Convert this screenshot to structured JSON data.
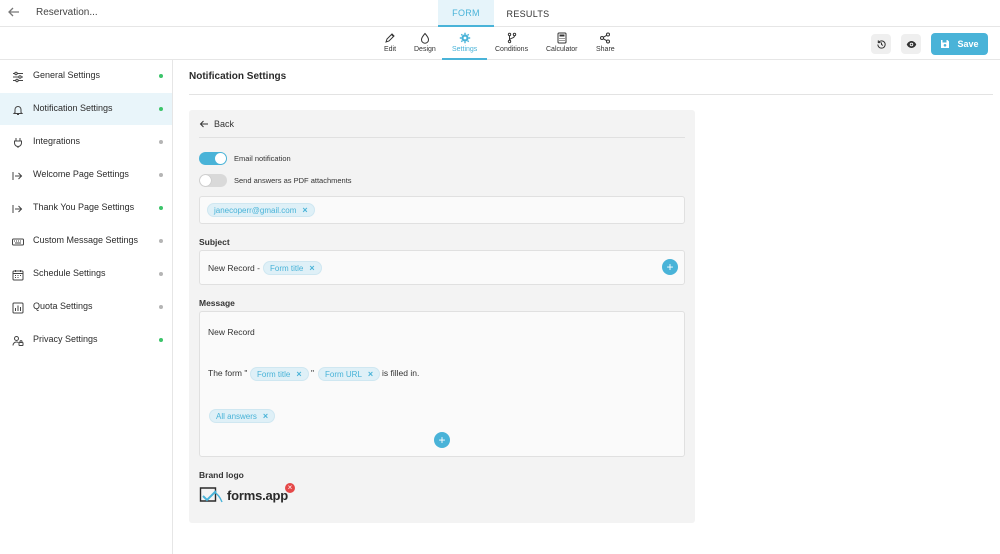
{
  "header": {
    "form_name": "Reservation...",
    "tabs": [
      {
        "label": "FORM",
        "active": true
      },
      {
        "label": "RESULTS",
        "active": false
      }
    ],
    "save_label": "Save"
  },
  "toolbar": {
    "items": [
      {
        "label": "Edit",
        "icon": "pencil-icon"
      },
      {
        "label": "Design",
        "icon": "droplet-icon"
      },
      {
        "label": "Settings",
        "icon": "gear-icon",
        "active": true
      },
      {
        "label": "Conditions",
        "icon": "branch-icon"
      },
      {
        "label": "Calculator",
        "icon": "calculator-icon"
      },
      {
        "label": "Share",
        "icon": "share-icon"
      }
    ]
  },
  "sidebar": {
    "items": [
      {
        "label": "General Settings",
        "icon": "sliders-icon",
        "status": "on"
      },
      {
        "label": "Notification Settings",
        "icon": "bell-icon",
        "status": "on",
        "active": true
      },
      {
        "label": "Integrations",
        "icon": "plug-icon",
        "status": "off"
      },
      {
        "label": "Welcome Page Settings",
        "icon": "entry-icon",
        "status": "off"
      },
      {
        "label": "Thank You Page Settings",
        "icon": "exit-icon",
        "status": "on"
      },
      {
        "label": "Custom Message Settings",
        "icon": "keyboard-icon",
        "status": "off"
      },
      {
        "label": "Schedule Settings",
        "icon": "calendar-icon",
        "status": "off"
      },
      {
        "label": "Quota Settings",
        "icon": "chart-icon",
        "status": "off"
      },
      {
        "label": "Privacy Settings",
        "icon": "user-lock-icon",
        "status": "on"
      }
    ]
  },
  "main": {
    "title": "Notification Settings",
    "back_label": "Back",
    "email_notification": {
      "label": "Email notification",
      "enabled": true
    },
    "pdf_attachments": {
      "label": "Send answers as PDF attachments",
      "enabled": false
    },
    "recipients": [
      "janecoperr@gmail.com"
    ],
    "subject": {
      "label": "Subject",
      "prefix": "New Record -",
      "tag": "Form title"
    },
    "message": {
      "label": "Message",
      "line1": "New Record",
      "line2_prefix": "The form \"",
      "tag_title": "Form title",
      "quote_mid": "\"",
      "tag_url": "Form URL",
      "line2_suffix": "is filled in.",
      "tag_answers": "All answers"
    },
    "brand_logo": {
      "label": "Brand logo",
      "logo_text": "forms.app"
    }
  },
  "colors": {
    "accent": "#49b3d8",
    "status_on": "#3cc46a",
    "status_off": "#b5b5b5",
    "remove": "#e54848"
  }
}
